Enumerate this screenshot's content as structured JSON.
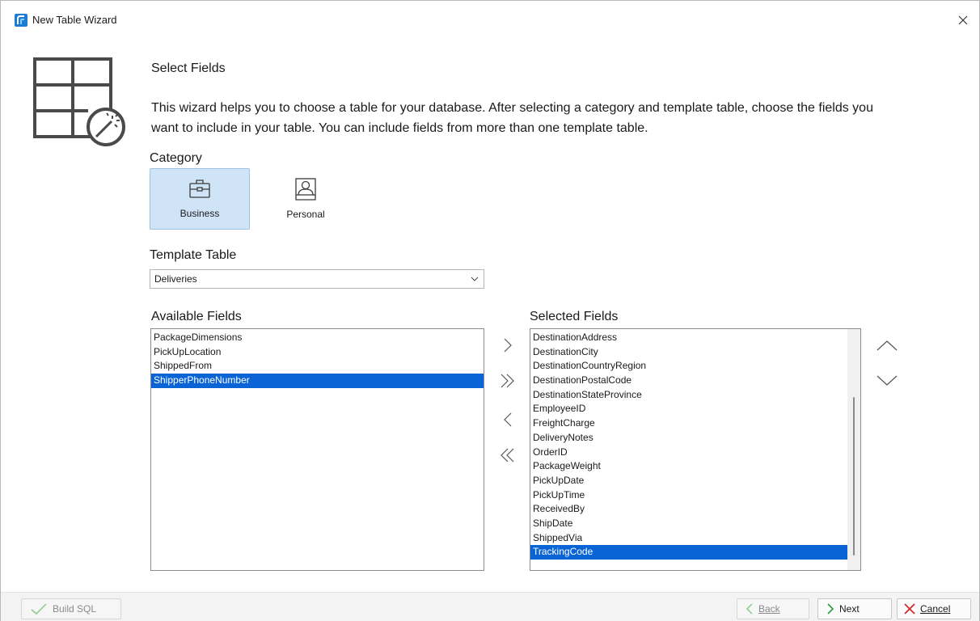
{
  "window": {
    "title": "New Table Wizard",
    "close_icon": "close-icon"
  },
  "wizard": {
    "icon": "table-wizard-icon",
    "heading": "Select Fields",
    "description_line1": "This wizard helps you to choose a table for your database. After selecting a category and template table, choose the fields you",
    "description_line2": "want to include in your table. You can include fields from more than one template table."
  },
  "category": {
    "label": "Category",
    "options": [
      {
        "label": "Business",
        "icon": "briefcase-icon",
        "selected": true
      },
      {
        "label": "Personal",
        "icon": "person-icon",
        "selected": false
      }
    ]
  },
  "template_table": {
    "label": "Template Table",
    "value": "Deliveries"
  },
  "available_fields": {
    "label": "Available Fields",
    "items": [
      "PackageDimensions",
      "PickUpLocation",
      "ShippedFrom",
      "ShipperPhoneNumber"
    ],
    "selected_index": 3
  },
  "selected_fields": {
    "label": "Selected Fields",
    "items": [
      "DestinationAddress",
      "DestinationCity",
      "DestinationCountryRegion",
      "DestinationPostalCode",
      "DestinationStateProvince",
      "EmployeeID",
      "FreightCharge",
      "DeliveryNotes",
      "OrderID",
      "PackageWeight",
      "PickUpDate",
      "PickUpTime",
      "ReceivedBy",
      "ShipDate",
      "ShippedVia",
      "TrackingCode"
    ],
    "selected_index": 15
  },
  "move_buttons": {
    "add_one": "chevron-right-icon",
    "add_all": "double-chevron-right-icon",
    "remove_one": "chevron-left-icon",
    "remove_all": "double-chevron-left-icon",
    "move_up": "chevron-up-icon",
    "move_down": "chevron-down-icon"
  },
  "footer": {
    "build_sql": "Build SQL",
    "back": "Back",
    "next": "Next",
    "cancel": "Cancel"
  },
  "colors": {
    "selection": "#0a64d6",
    "tile_selected": "#cfe4f7",
    "cancel_red": "#d22b2b",
    "next_green": "#2a9d3c",
    "build_sql_check": "#9ccf9c"
  }
}
